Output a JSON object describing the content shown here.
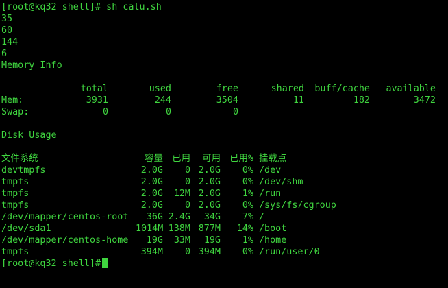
{
  "terminal": {
    "prompt_1": "[root@kq32 shell]# sh calu.sh",
    "outputs": [
      "35",
      "60",
      "144",
      "6"
    ],
    "memory_heading": "Memory Info",
    "free": {
      "header": [
        "total",
        "used",
        "free",
        "shared",
        "buff/cache",
        "available"
      ],
      "rows": [
        {
          "label": "Mem:",
          "values": [
            "3931",
            "244",
            "3504",
            "11",
            "182",
            "3472"
          ]
        },
        {
          "label": "Swap:",
          "values": [
            "0",
            "0",
            "0",
            "",
            "",
            ""
          ]
        }
      ]
    },
    "disk_heading": "Disk Usage",
    "df": {
      "header": [
        "文件系统",
        "容量",
        "已用",
        "可用",
        "已用%",
        "挂载点"
      ],
      "rows": [
        [
          "devtmpfs",
          "2.0G",
          "0",
          "2.0G",
          "0%",
          "/dev"
        ],
        [
          "tmpfs",
          "2.0G",
          "0",
          "2.0G",
          "0%",
          "/dev/shm"
        ],
        [
          "tmpfs",
          "2.0G",
          "12M",
          "2.0G",
          "1%",
          "/run"
        ],
        [
          "tmpfs",
          "2.0G",
          "0",
          "2.0G",
          "0%",
          "/sys/fs/cgroup"
        ],
        [
          "/dev/mapper/centos-root",
          "36G",
          "2.4G",
          "34G",
          "7%",
          "/"
        ],
        [
          "/dev/sda1",
          "1014M",
          "138M",
          "877M",
          "14%",
          "/boot"
        ],
        [
          "/dev/mapper/centos-home",
          "19G",
          "33M",
          "19G",
          "1%",
          "/home"
        ],
        [
          "tmpfs",
          "394M",
          "0",
          "394M",
          "0%",
          "/run/user/0"
        ]
      ]
    },
    "prompt_2": "[root@kq32 shell]#"
  },
  "colors": {
    "background": "#000000",
    "text": "#3fd43f",
    "cursor": "#3fd43f"
  }
}
